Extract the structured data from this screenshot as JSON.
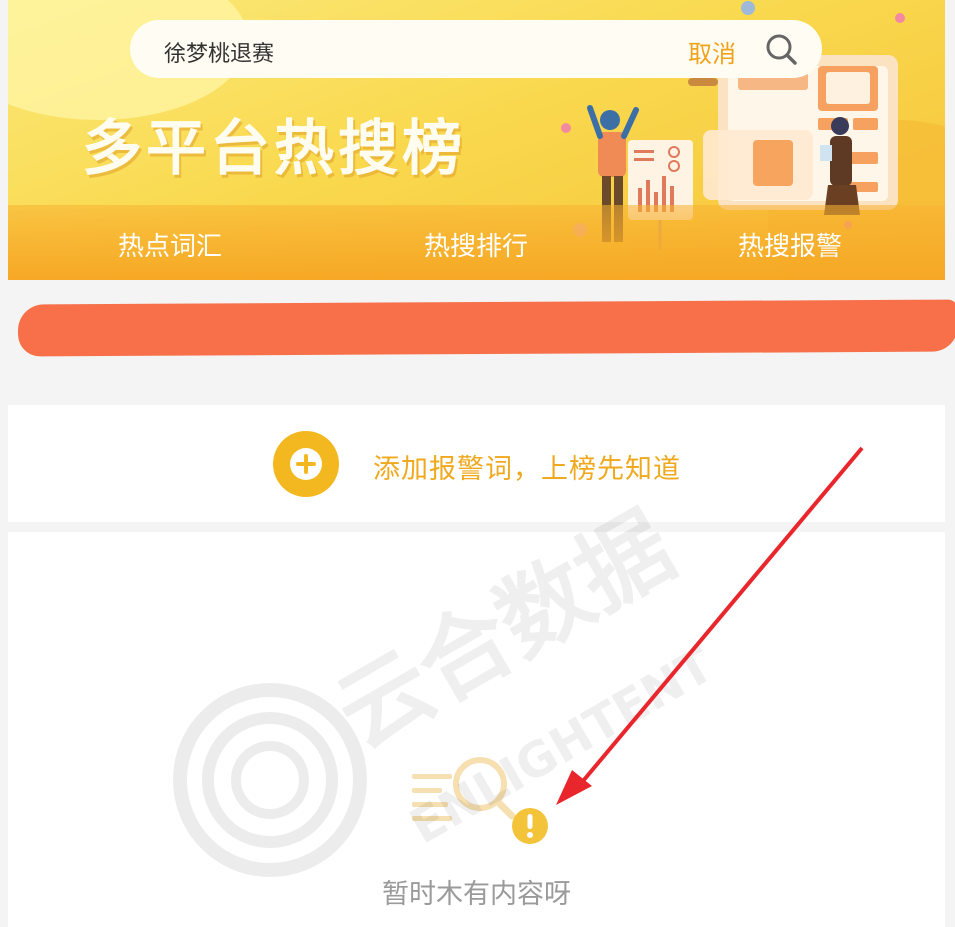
{
  "search": {
    "query": "徐梦桃退赛",
    "cancel_label": "取消"
  },
  "banner": {
    "headline": "多平台热搜榜"
  },
  "tabs": [
    {
      "label": "热点词汇"
    },
    {
      "label": "热搜排行"
    },
    {
      "label": "热搜报警"
    }
  ],
  "alert": {
    "add_label": "添加报警词，上榜先知道"
  },
  "empty_state": {
    "message": "暂时木有内容呀"
  },
  "watermark": {
    "brand_cn": "云合数据",
    "brand_en": "ENLIGHTENT"
  },
  "colors": {
    "accent": "#f3b820",
    "accent_text": "#f0a91e",
    "banner_start": "#fbe97a",
    "banner_end": "#f7c237",
    "redaction": "#f7704a",
    "annotation_arrow": "#e8262b"
  }
}
